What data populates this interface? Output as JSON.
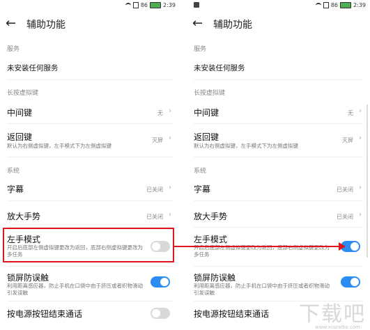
{
  "screens": [
    {
      "status": {
        "signal": "86",
        "time": "2:39"
      },
      "title": "辅助功能",
      "sections": {
        "services": "服务",
        "longpress": "长按虚拟键",
        "system": "系统"
      },
      "items": {
        "no_service": "未安装任何服务",
        "middle_key": {
          "label": "中间键",
          "value": "无"
        },
        "back_key": {
          "label": "返回键",
          "sub": "默认为右侧虚拟键，左手模式下为左侧虚拟键",
          "value": "灭屏"
        },
        "captions": {
          "label": "字幕",
          "value": "已关闭"
        },
        "magnify": {
          "label": "放大手势",
          "value": "已关闭"
        },
        "left_hand": {
          "label": "左手模式",
          "sub": "开启后底部左侧虚拟键更改为返回，底部右侧虚拟键更改为多任务",
          "on": false
        },
        "screen_lock": {
          "label": "锁屏防误触",
          "sub": "利用距离感应器，防止手机在口袋中由于挤压或者织物滑动引发误触",
          "on": true
        },
        "power_end": {
          "label": "按电源按钮结束通话",
          "on": false
        }
      }
    },
    {
      "status": {
        "signal": "86",
        "time": "2:39"
      },
      "title": "辅助功能",
      "sections": {
        "services": "服务",
        "longpress": "长按虚拟键",
        "system": "系统"
      },
      "items": {
        "no_service": "未安装任何服务",
        "middle_key": {
          "label": "中间键",
          "value": "无"
        },
        "back_key": {
          "label": "返回键",
          "sub": "默认为右侧虚拟键，左手模式下为左侧虚拟键",
          "value": "灭屏"
        },
        "captions": {
          "label": "字幕",
          "value": "已关闭"
        },
        "magnify": {
          "label": "放大手势",
          "value": "已关闭"
        },
        "left_hand": {
          "label": "左手模式",
          "sub": "开启后底部左侧虚拟键更改为返回，底部右侧虚拟键更改为多任务",
          "on": true
        },
        "screen_lock": {
          "label": "锁屏防误触",
          "sub": "利用距离感应器，防止手机在口袋中由于挤压或者织物滑动引发误触",
          "on": true
        },
        "power_end": {
          "label": "按电源按钮结束通话",
          "on": false
        }
      }
    }
  ],
  "watermark": {
    "brand": "下载吧",
    "url": "www.xiazaiba.com"
  },
  "colors": {
    "toggle_on": "#2b8cf2",
    "toggle_off": "#d9d9d9",
    "highlight": "#e1141d",
    "battery": "#4caf50"
  }
}
